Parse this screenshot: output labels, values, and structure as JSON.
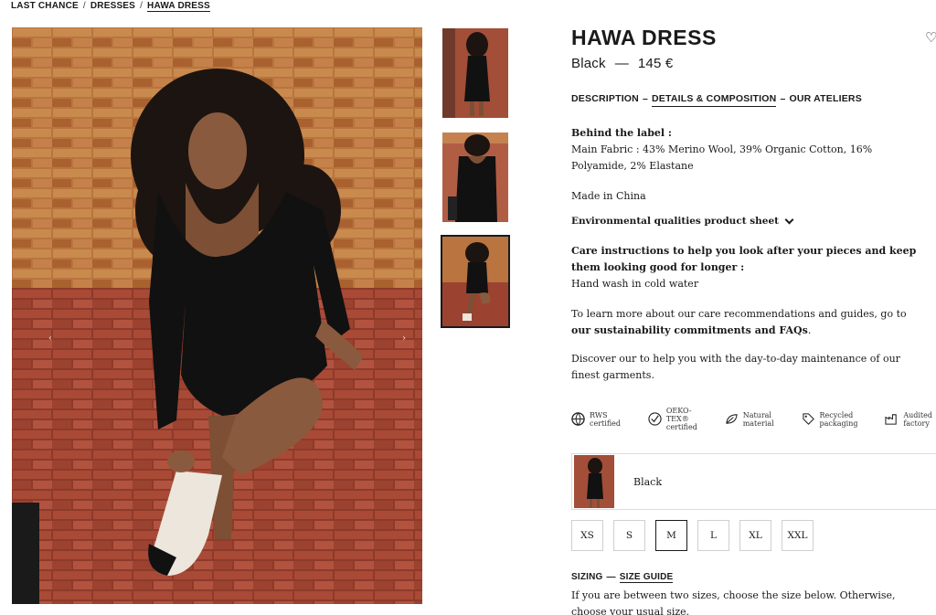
{
  "breadcrumb": {
    "items": [
      "LAST CHANCE",
      "DRESSES",
      "HAWA DRESS"
    ],
    "separator": "/"
  },
  "product": {
    "title": "HAWA DRESS",
    "color": "Black",
    "dash": "—",
    "price": "145 €"
  },
  "tabs": {
    "description": "DESCRIPTION",
    "sep1": "–",
    "details": "DETAILS & COMPOSITION",
    "sep2": "–",
    "ateliers": "OUR ATELIERS"
  },
  "details": {
    "behind_label": "Behind the label :",
    "fabric": "Main Fabric : 43% Merino Wool, 39% Organic Cotton, 16% Polyamide, 2% Elastane",
    "made_in": "Made in China",
    "env_label": "Environmental qualities product sheet",
    "care_heading": "Care instructions to help you look after your pieces and keep them looking good for longer :",
    "care_text": "Hand wash in cold water",
    "learn_prefix": "To learn more about our care recommendations and guides, go to ",
    "learn_link": "our sustainability commitments and FAQs",
    "learn_suffix": ".",
    "discover": "Discover our to help you with the day-to-day maintenance of our finest garments."
  },
  "badges": [
    {
      "icon": "rws-globe-icon",
      "line1": "RWS",
      "line2": "certified"
    },
    {
      "icon": "check-circle-icon",
      "line1": "OEKO-",
      "line2": "TEX®",
      "line3": "certified"
    },
    {
      "icon": "leaf-icon",
      "line1": "Natural",
      "line2": "material"
    },
    {
      "icon": "tag-icon",
      "line1": "Recycled",
      "line2": "packaging"
    },
    {
      "icon": "factory-icon",
      "line1": "Audited",
      "line2": "factory"
    }
  ],
  "color_option": {
    "label": "Black"
  },
  "sizes": [
    "XS",
    "S",
    "M",
    "L",
    "XL",
    "XXL"
  ],
  "selected_size": "M",
  "sizing": {
    "label": "SIZING",
    "dash": "—",
    "guide": "SIZE GUIDE",
    "text": "If you are between two sizes, choose the size below. Otherwise, choose your usual size."
  },
  "carousel": {
    "prev": "‹",
    "next": "›"
  },
  "icons": {
    "wishlist": "heart-icon"
  },
  "colors": {
    "text": "#1a1a1a",
    "brick": "#a34e38",
    "dress": "#111111"
  }
}
